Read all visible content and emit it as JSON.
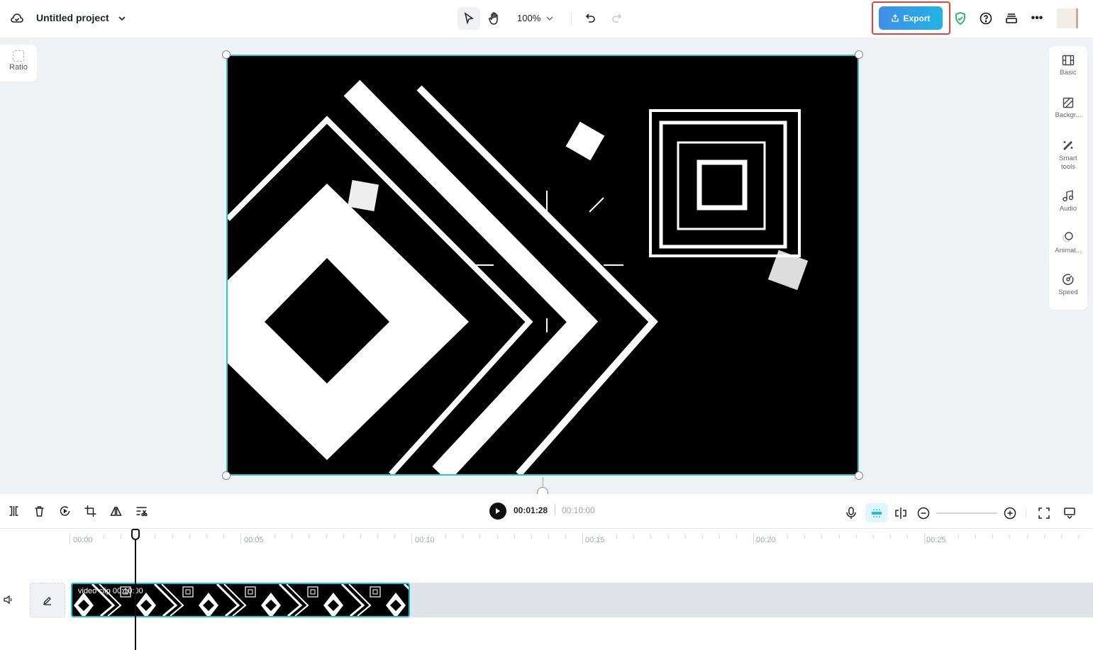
{
  "header": {
    "project_title": "Untitled project",
    "zoom": "100%",
    "export_label": "Export"
  },
  "left_panel": {
    "ratio_label": "Ratio"
  },
  "right_panel": {
    "items": [
      {
        "label": "Basic",
        "icon": "film-icon"
      },
      {
        "label": "Backgr...",
        "icon": "background-icon"
      },
      {
        "label": "Smart tools",
        "icon": "magic-wand-icon"
      },
      {
        "label": "Audio",
        "icon": "music-note-icon"
      },
      {
        "label": "Animat...",
        "icon": "animation-icon"
      },
      {
        "label": "Speed",
        "icon": "speedometer-icon"
      }
    ]
  },
  "playback": {
    "current_time": "00:01:28",
    "total_time": "00:10:00"
  },
  "ruler": {
    "labels": [
      "00:00",
      "00:05",
      "00:10",
      "00:15",
      "00:20",
      "00:25"
    ]
  },
  "clip": {
    "label": "video clip",
    "duration": "00:10:00"
  },
  "colors": {
    "accent": "#2bc4cf",
    "export_gradient_start": "#3f8ee8",
    "export_gradient_end": "#22b3e6",
    "highlight": "#e8413c"
  }
}
